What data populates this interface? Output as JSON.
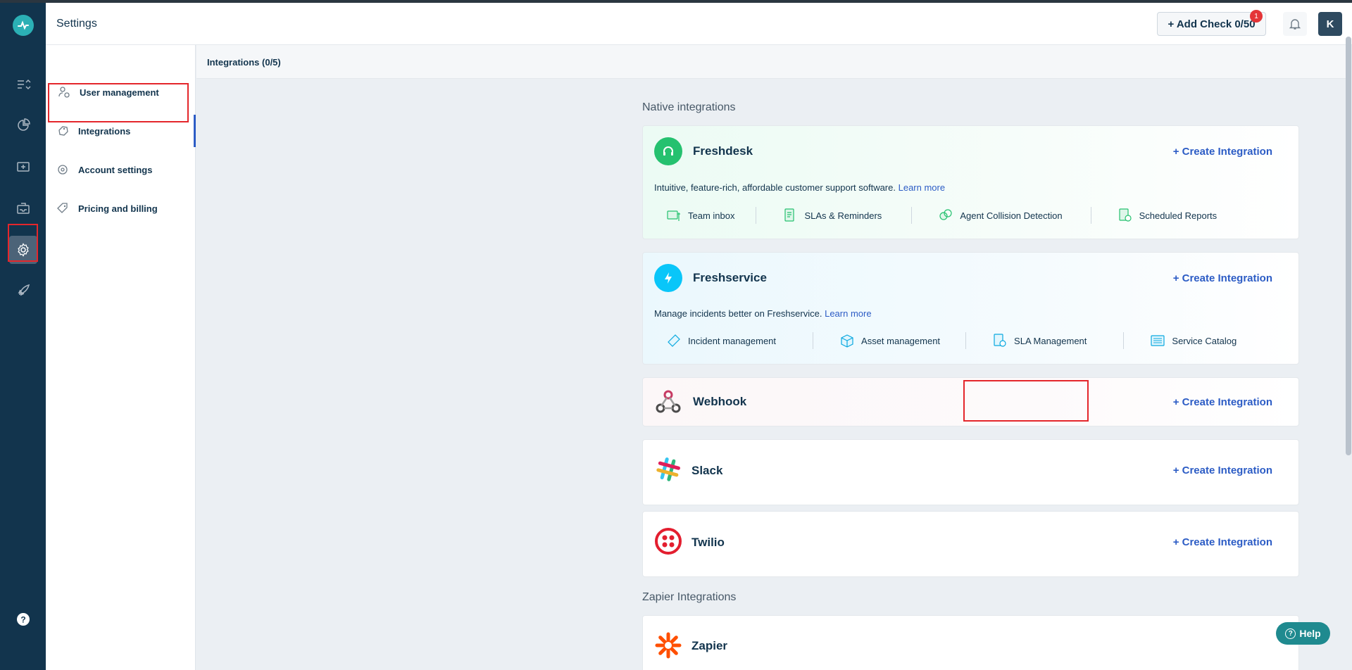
{
  "header": {
    "title": "Settings",
    "add_check_label": "+ Add Check 0/50",
    "notification_count": "1",
    "avatar_initial": "K"
  },
  "rail": {
    "items": [
      "logo-icon",
      "checks-icon",
      "reports-icon",
      "status-page-icon",
      "inbox-icon",
      "settings-icon",
      "rocket-icon",
      "help-circle-icon"
    ],
    "active": "settings-icon"
  },
  "sidenav": {
    "items": [
      {
        "label": "User management",
        "icon": "user-management-icon"
      },
      {
        "label": "Integrations",
        "icon": "integrations-icon"
      },
      {
        "label": "Account settings",
        "icon": "account-settings-icon"
      },
      {
        "label": "Pricing and billing",
        "icon": "pricing-icon"
      }
    ],
    "active": "Integrations"
  },
  "subheader": {
    "title": "Integrations (0/5)"
  },
  "sections": {
    "native": "Native integrations",
    "zapier": "Zapier Integrations"
  },
  "integrations": {
    "freshdesk": {
      "name": "Freshdesk",
      "action": "+ Create Integration",
      "description": "Intuitive, feature-rich, affordable customer support software.",
      "learn_more": "Learn more",
      "features": [
        "Team inbox",
        "SLAs & Reminders",
        "Agent Collision Detection",
        "Scheduled Reports"
      ]
    },
    "freshservice": {
      "name": "Freshservice",
      "action": "+ Create Integration",
      "description": "Manage incidents better on Freshservice.",
      "learn_more": "Learn more",
      "features": [
        "Incident management",
        "Asset management",
        "SLA Management",
        "Service Catalog"
      ]
    },
    "webhook": {
      "name": "Webhook",
      "action": "+ Create Integration"
    },
    "slack": {
      "name": "Slack",
      "action": "+ Create Integration"
    },
    "twilio": {
      "name": "Twilio",
      "action": "+ Create Integration"
    },
    "zapier": {
      "name": "Zapier"
    }
  },
  "help_button": {
    "label": "Help"
  },
  "colors": {
    "rail_bg": "#12344d",
    "accent_link": "#2c5cc5",
    "highlight_red": "#e4262b",
    "freshdesk_green": "#25c16f",
    "freshservice_blue": "#09c6f9",
    "twilio_red": "#e31e2f",
    "zapier_orange": "#ff4f00"
  }
}
